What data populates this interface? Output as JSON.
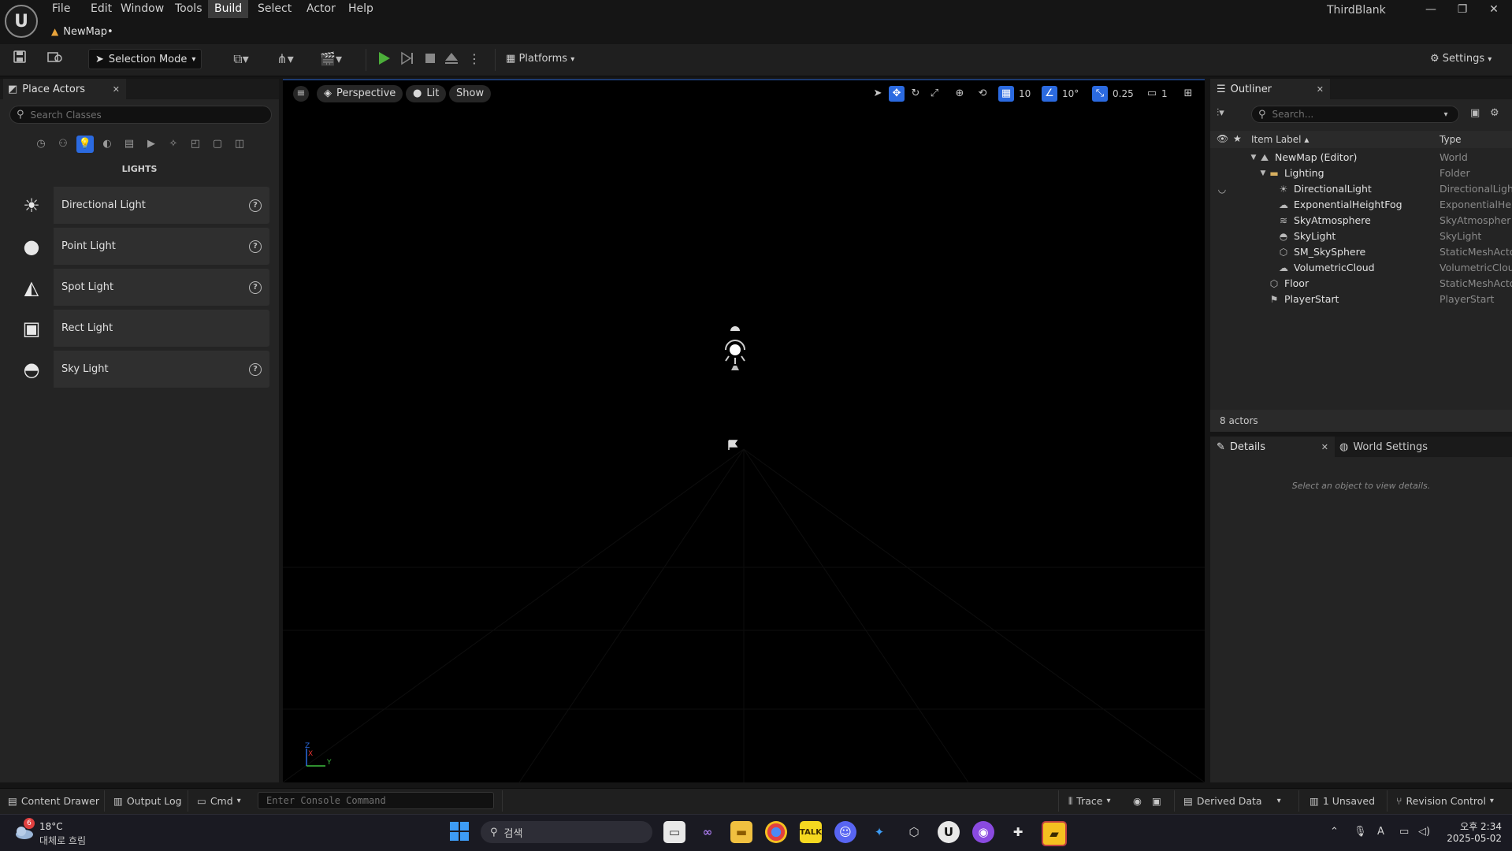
{
  "titlebar": {
    "menus": [
      "File",
      "Edit",
      "Window",
      "Tools",
      "Build",
      "Select",
      "Actor",
      "Help"
    ],
    "active_menu": "Build",
    "map_tab": "NewMap•",
    "project_name": "ThirdBlank",
    "window_controls": [
      "minimize-icon",
      "restore-icon",
      "close-icon"
    ]
  },
  "toolbar": {
    "selection_mode": "Selection Mode",
    "platforms": "Platforms",
    "settings": "Settings"
  },
  "place_actors": {
    "tab_label": "Place Actors",
    "search_placeholder": "Search Classes",
    "section_title": "LIGHTS",
    "categories": [
      "recent-icon",
      "basic-icon",
      "lights-icon",
      "shapes-icon",
      "cinematic-icon",
      "visual-effects-icon",
      "volumes-icon",
      "geometry-icon",
      "all-classes-icon",
      "misc-icon"
    ],
    "active_category": "lights-icon",
    "items": [
      {
        "label": "Directional Light",
        "icon": "directional-light-icon",
        "help": true
      },
      {
        "label": "Point Light",
        "icon": "point-light-icon",
        "help": true
      },
      {
        "label": "Spot Light",
        "icon": "spot-light-icon",
        "help": true
      },
      {
        "label": "Rect Light",
        "icon": "rect-light-icon",
        "help": false
      },
      {
        "label": "Sky Light",
        "icon": "sky-light-icon",
        "help": true
      }
    ]
  },
  "viewport": {
    "perspective": "Perspective",
    "view_mode": "Lit",
    "show": "Show",
    "grid_snap": "10",
    "rotation_snap": "10°",
    "scale_snap": "0.25",
    "camera_speed": "1",
    "axis_labels": {
      "z": "Z",
      "x": "X",
      "y": "Y"
    }
  },
  "outliner": {
    "tab_label": "Outliner",
    "search_placeholder": "Search...",
    "col_label": "Item Label",
    "col_type": "Type",
    "rows": [
      {
        "label": "NewMap (Editor)",
        "type": "World",
        "indent": 0,
        "icon": "world-icon",
        "expander": true
      },
      {
        "label": "Lighting",
        "type": "Folder",
        "indent": 1,
        "icon": "folder-icon",
        "expander": true
      },
      {
        "label": "DirectionalLight",
        "type": "DirectionalLigh",
        "indent": 2,
        "icon": "directional-light-icon",
        "expander": false
      },
      {
        "label": "ExponentialHeightFog",
        "type": "ExponentialHei",
        "indent": 2,
        "icon": "fog-icon",
        "expander": false
      },
      {
        "label": "SkyAtmosphere",
        "type": "SkyAtmospher",
        "indent": 2,
        "icon": "sky-atmosphere-icon",
        "expander": false
      },
      {
        "label": "SkyLight",
        "type": "SkyLight",
        "indent": 2,
        "icon": "sky-light-icon",
        "expander": false
      },
      {
        "label": "SM_SkySphere",
        "type": "StaticMeshActo",
        "indent": 2,
        "icon": "static-mesh-icon",
        "expander": false
      },
      {
        "label": "VolumetricCloud",
        "type": "VolumetricClou",
        "indent": 2,
        "icon": "cloud-icon",
        "expander": false
      },
      {
        "label": "Floor",
        "type": "StaticMeshActo",
        "indent": 1,
        "icon": "static-mesh-icon",
        "expander": false
      },
      {
        "label": "PlayerStart",
        "type": "PlayerStart",
        "indent": 1,
        "icon": "player-start-icon",
        "expander": false
      }
    ],
    "actor_count": "8 actors"
  },
  "details": {
    "tab_label": "Details",
    "world_settings_label": "World Settings",
    "empty_message": "Select an object to view details."
  },
  "statusbar": {
    "content_drawer": "Content Drawer",
    "output_log": "Output Log",
    "cmd": "Cmd",
    "console_placeholder": "Enter Console Command",
    "trace": "Trace",
    "derived_data": "Derived Data",
    "unsaved": "1 Unsaved",
    "revision_control": "Revision Control"
  },
  "taskbar": {
    "weather_badge": "6",
    "temperature": "18°C",
    "weather_desc": "대체로 흐림",
    "search_label": "검색",
    "time": "오후 2:34",
    "date": "2025-05-02"
  },
  "colors": {
    "accent_blue": "#2b6ae0",
    "play_green": "#4cae3a",
    "warning_orange": "#e8a33a"
  }
}
